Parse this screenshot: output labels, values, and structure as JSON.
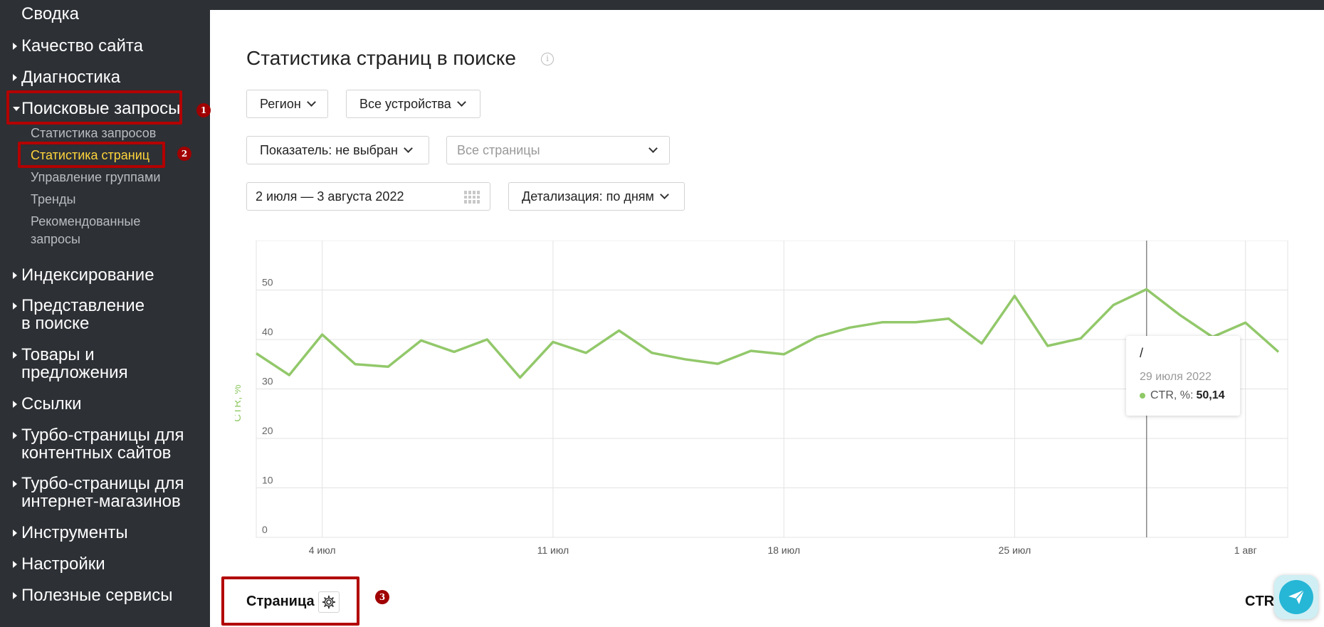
{
  "sidebar": {
    "summary": "Сводка",
    "items": [
      {
        "label": "Качество сайта"
      },
      {
        "label": "Диагностика"
      },
      {
        "label": "Поисковые запросы"
      },
      {
        "label": "Индексирование"
      },
      {
        "label": "Представление\nв поиске"
      },
      {
        "label": "Товары и\nпредложения"
      },
      {
        "label": "Ссылки"
      },
      {
        "label": "Турбо-страницы для\nконтентных сайтов"
      },
      {
        "label": "Турбо-страницы для\nинтернет-магазинов"
      },
      {
        "label": "Инструменты"
      },
      {
        "label": "Настройки"
      },
      {
        "label": "Полезные сервисы"
      }
    ],
    "subitems": [
      {
        "label": "Статистика запросов"
      },
      {
        "label": "Статистика страниц"
      },
      {
        "label": "Управление группами"
      },
      {
        "label": "Тренды"
      },
      {
        "label": "Рекомендованные\nзапросы"
      }
    ]
  },
  "annotations": {
    "badge1": "1",
    "badge2": "2",
    "badge3": "3",
    "color": "#b30000"
  },
  "main": {
    "title": "Статистика страниц в поиске",
    "info_icon": "i",
    "region_label": "Регион",
    "devices_label": "Все устройства",
    "metric_label": "Показатель: не выбран",
    "pages_placeholder": "Все страницы",
    "date_range": "2 июля — 3 августа 2022",
    "detail_label": "Детализация: по дням"
  },
  "tooltip": {
    "title": "/",
    "date": "29 июля 2022",
    "metric": "CTR, %:",
    "value": "50,14"
  },
  "table": {
    "page_col": "Страница",
    "ctr_col": "CTR"
  },
  "chart_data": {
    "type": "line",
    "ylabel": "CTR, %",
    "ylim": [
      0,
      60
    ],
    "yticks": [
      0,
      10,
      20,
      30,
      40,
      50
    ],
    "xtick_labels": [
      "4 июл",
      "11 июл",
      "18 июл",
      "25 июл",
      "1 авг"
    ],
    "xtick_index": [
      2,
      9,
      16,
      23,
      30
    ],
    "grid": true,
    "line_color": "#92c86a",
    "series": [
      {
        "values": [
          37.2,
          32.8,
          41.0,
          35.0,
          34.5,
          39.8,
          37.5,
          40.0,
          32.3,
          39.5,
          37.3,
          41.8,
          37.3,
          36.0,
          35.1,
          37.7,
          37.0,
          40.5,
          42.4,
          43.5,
          43.5,
          44.2,
          39.2,
          48.8,
          38.7,
          40.2,
          47.0,
          50.14,
          45.0,
          40.5,
          43.4,
          37.5
        ]
      }
    ],
    "highlight_index": 27
  }
}
